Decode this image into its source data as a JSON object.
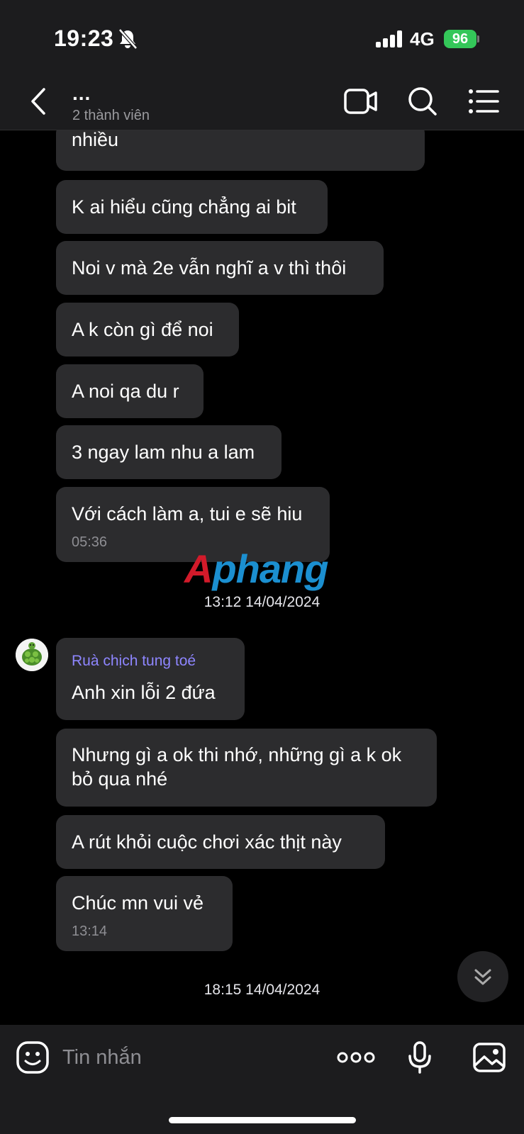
{
  "status_bar": {
    "time": "19:23",
    "network": "4G",
    "battery": "96",
    "icons": [
      "bell-slash-icon",
      "signal-icon",
      "battery-icon"
    ]
  },
  "header": {
    "title": "...",
    "subtitle": "2 thành viên",
    "icons": [
      "back-icon",
      "video-call-icon",
      "search-icon",
      "list-menu-icon"
    ]
  },
  "messages": [
    {
      "text": "nhiều"
    },
    {
      "text": "K ai hiểu cũng chẳng ai bit"
    },
    {
      "text": "Noi v mà 2e vẫn nghĩ a v thì thôi"
    },
    {
      "text": "A k còn gì để noi"
    },
    {
      "text": "A noi qa du r"
    },
    {
      "text": "3 ngay lam nhu a lam"
    },
    {
      "text": "Với cách làm a, tui e sẽ hiu",
      "time": "05:36"
    },
    {
      "sender": "Ruà chịch tung toé",
      "text": "Anh xin lỗi 2 đứa"
    },
    {
      "text": "Nhưng gì a ok thi nhớ, những gì a k ok bỏ qua nhé"
    },
    {
      "text": "A rút khỏi cuộc chơi xác thịt này"
    },
    {
      "text": "Chúc mn vui vẻ",
      "time": "13:14"
    }
  ],
  "date_separators": [
    "13:12 14/04/2024",
    "18:15 14/04/2024"
  ],
  "watermark": {
    "part1": "A",
    "part2": "phang"
  },
  "input_bar": {
    "placeholder": "Tin nhắn",
    "icons": [
      "sticker-icon",
      "more-icon",
      "microphone-icon",
      "image-icon"
    ]
  },
  "colors": {
    "background": "#000000",
    "bubble": "#2c2c2e",
    "sender_name": "#8e86ff",
    "battery": "#34c759"
  }
}
